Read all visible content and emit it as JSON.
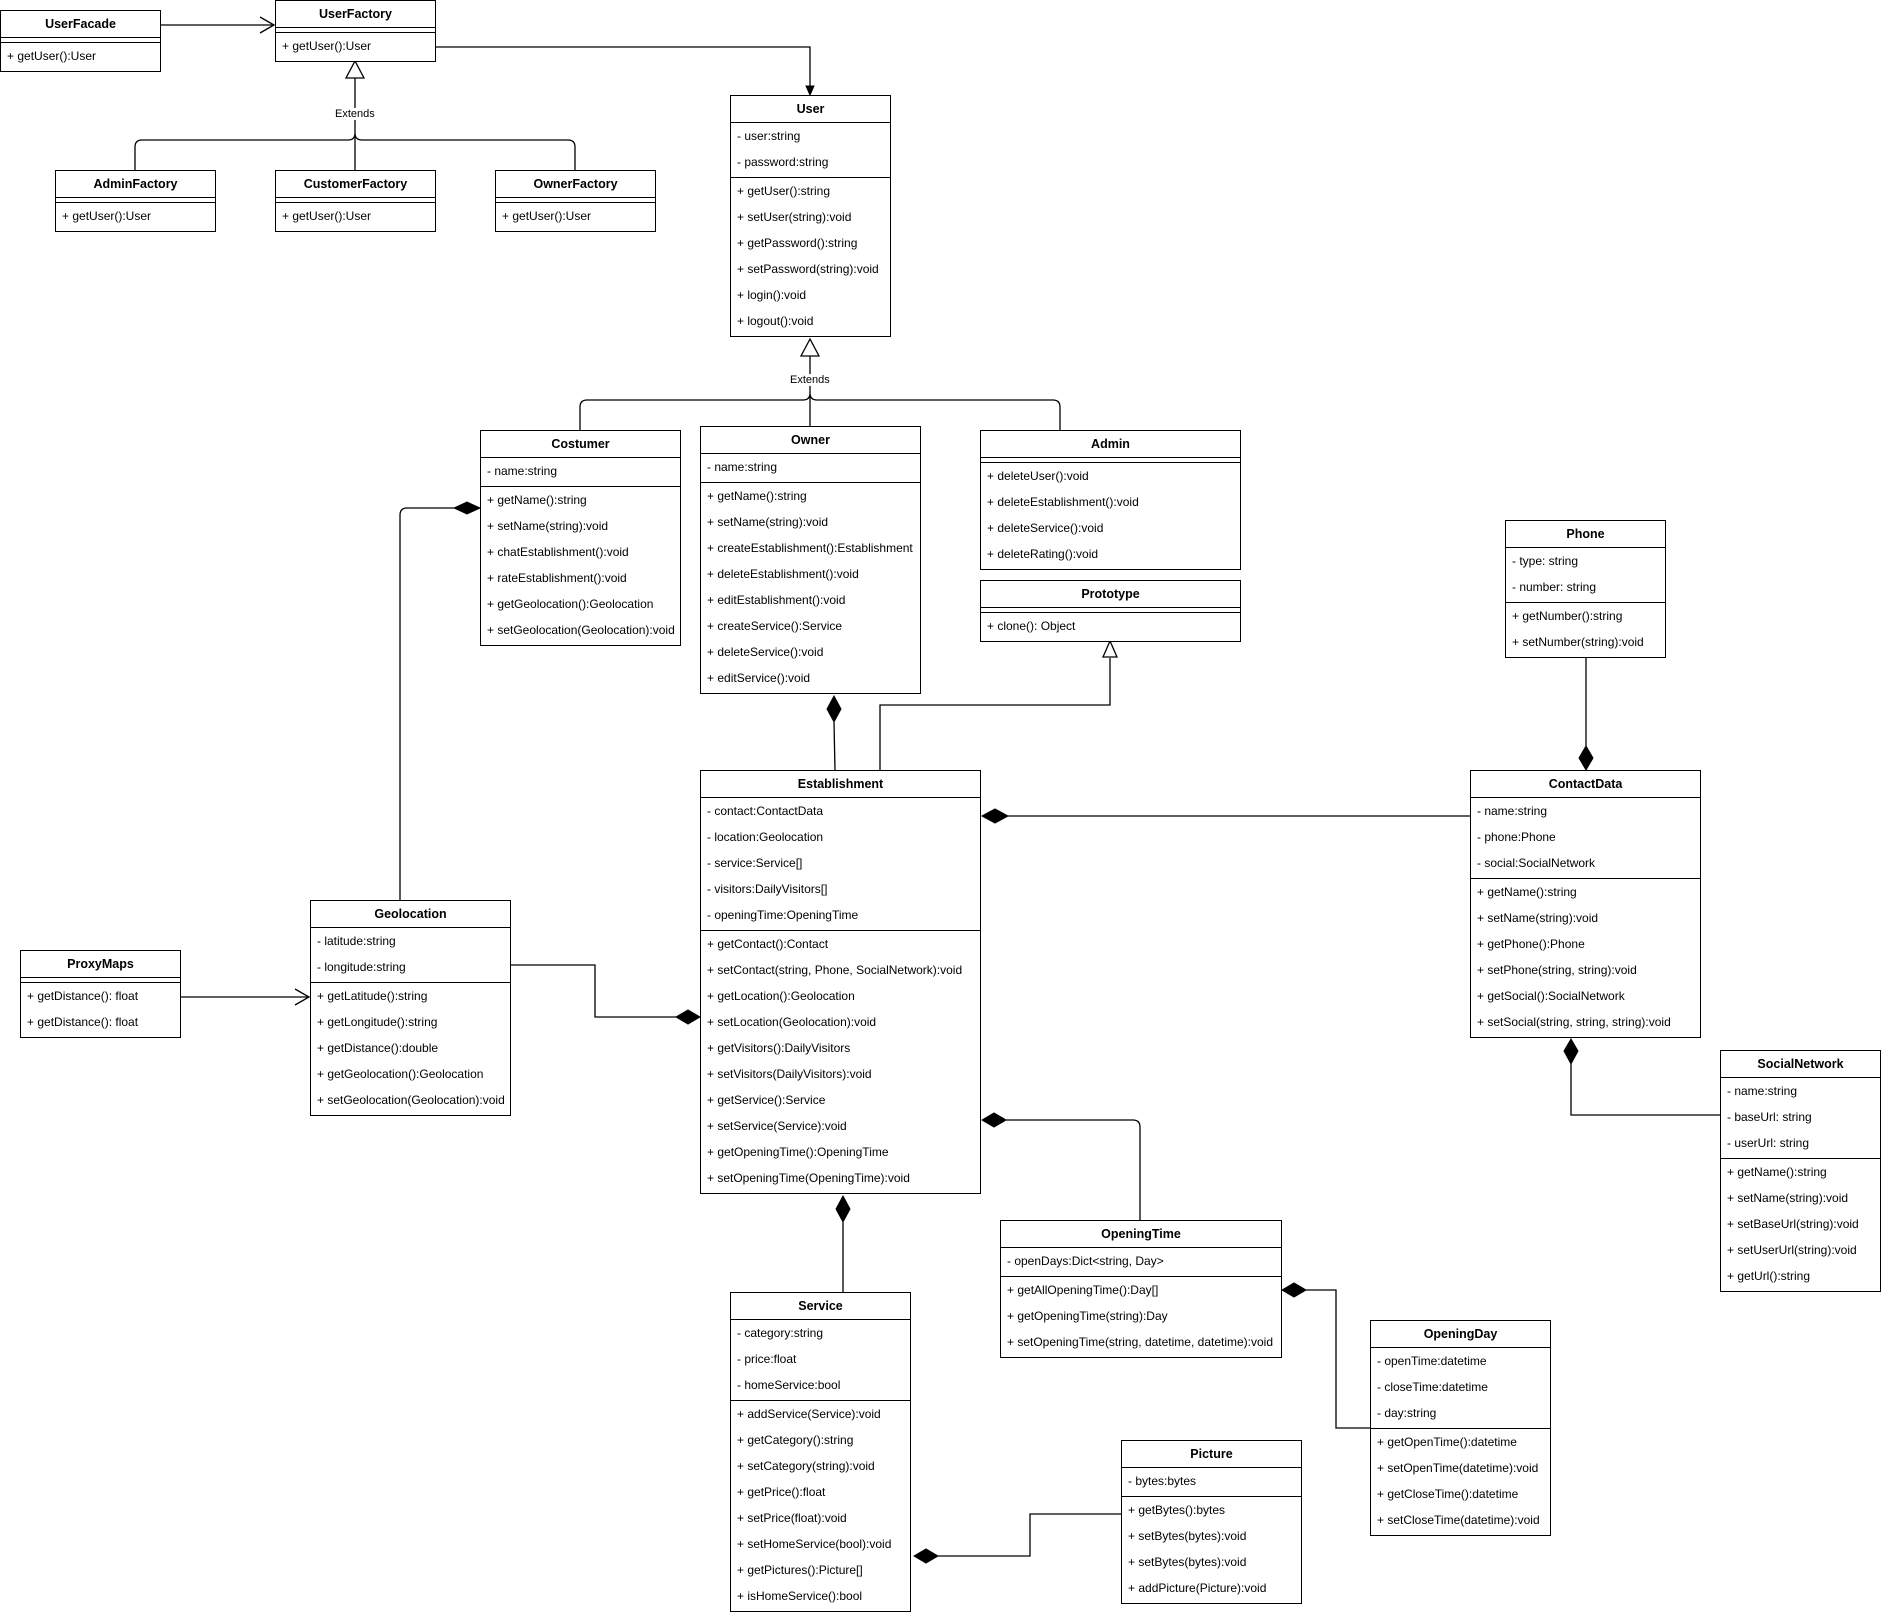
{
  "diagram": {
    "type": "UML class diagram",
    "relation_labels": {
      "extends_factory": "Extends",
      "extends_user": "Extends"
    },
    "classes": {
      "UserFacade": {
        "name": "UserFacade",
        "attributes": [],
        "methods": [
          "+ getUser():User"
        ]
      },
      "UserFactory": {
        "name": "UserFactory",
        "attributes": [],
        "methods": [
          "+ getUser():User"
        ]
      },
      "AdminFactory": {
        "name": "AdminFactory",
        "attributes": [],
        "methods": [
          "+ getUser():User"
        ]
      },
      "CustomerFactory": {
        "name": "CustomerFactory",
        "attributes": [],
        "methods": [
          "+ getUser():User"
        ]
      },
      "OwnerFactory": {
        "name": "OwnerFactory",
        "attributes": [],
        "methods": [
          "+ getUser():User"
        ]
      },
      "User": {
        "name": "User",
        "attributes": [
          "- user:string",
          "- password:string"
        ],
        "methods": [
          "+ getUser():string",
          "+ setUser(string):void",
          "+ getPassword():string",
          "+ setPassword(string):void",
          "+ login():void",
          "+ logout():void"
        ]
      },
      "Costumer": {
        "name": "Costumer",
        "attributes": [
          "- name:string"
        ],
        "methods": [
          "+ getName():string",
          "+ setName(string):void",
          "+ chatEstablishment():void",
          "+ rateEstablishment():void",
          "+ getGeolocation():Geolocation",
          "+ setGeolocation(Geolocation):void"
        ]
      },
      "Owner": {
        "name": "Owner",
        "attributes": [
          "- name:string"
        ],
        "methods": [
          "+ getName():string",
          "+ setName(string):void",
          "+ createEstablishment():Establishment",
          "+ deleteEstablishment():void",
          "+ editEstablishment():void",
          "+ createService():Service",
          "+ deleteService():void",
          "+ editService():void"
        ]
      },
      "Admin": {
        "name": "Admin",
        "attributes": [],
        "methods": [
          "+ deleteUser():void",
          "+ deleteEstablishment():void",
          "+ deleteService():void",
          "+ deleteRating():void"
        ]
      },
      "Prototype": {
        "name": "Prototype",
        "attributes": [],
        "methods": [
          "+ clone(): Object"
        ]
      },
      "Phone": {
        "name": "Phone",
        "attributes": [
          "- type: string",
          "- number: string"
        ],
        "methods": [
          "+ getNumber():string",
          "+ setNumber(string):void"
        ]
      },
      "Establishment": {
        "name": "Establishment",
        "attributes": [
          "- contact:ContactData",
          "- location:Geolocation",
          "- service:Service[]",
          "- visitors:DailyVisitors[]",
          "- openingTime:OpeningTime"
        ],
        "methods": [
          "+ getContact():Contact",
          "+ setContact(string, Phone, SocialNetwork):void",
          "+ getLocation():Geolocation",
          "+ setLocation(Geolocation):void",
          "+ getVisitors():DailyVisitors",
          "+ setVisitors(DailyVisitors):void",
          "+ getService():Service",
          "+ setService(Service):void",
          "+ getOpeningTime():OpeningTime",
          "+ setOpeningTime(OpeningTime):void"
        ]
      },
      "ContactData": {
        "name": "ContactData",
        "attributes": [
          "- name:string",
          "- phone:Phone",
          "- social:SocialNetwork"
        ],
        "methods": [
          "+ getName():string",
          "+ setName(string):void",
          "+ getPhone():Phone",
          "+ setPhone(string, string):void",
          "+ getSocial():SocialNetwork",
          "+ setSocial(string, string, string):void"
        ]
      },
      "Geolocation": {
        "name": "Geolocation",
        "attributes": [
          "- latitude:string",
          "- longitude:string"
        ],
        "methods": [
          "+ getLatitude():string",
          "+ getLongitude():string",
          "+ getDistance():double",
          "+ getGeolocation():Geolocation",
          "+ setGeolocation(Geolocation):void"
        ]
      },
      "ProxyMaps": {
        "name": "ProxyMaps",
        "attributes": [],
        "methods": [
          "+ getDistance(): float",
          "+ getDistance(): float"
        ]
      },
      "SocialNetwork": {
        "name": "SocialNetwork",
        "attributes": [
          "- name:string",
          "- baseUrl: string",
          "- userUrl: string"
        ],
        "methods": [
          "+ getName():string",
          "+ setName(string):void",
          "+ setBaseUrl(string):void",
          "+ setUserUrl(string):void",
          "+ getUrl():string"
        ]
      },
      "OpeningTime": {
        "name": "OpeningTime",
        "attributes": [
          "- openDays:Dict<string, Day>"
        ],
        "methods": [
          "+ getAllOpeningTime():Day[]",
          "+ getOpeningTime(string):Day",
          "+ setOpeningTime(string, datetime, datetime):void"
        ]
      },
      "Service": {
        "name": "Service",
        "attributes": [
          "- category:string",
          "- price:float",
          "- homeService:bool"
        ],
        "methods": [
          "+ addService(Service):void",
          "+ getCategory():string",
          "+ setCategory(string):void",
          "+ getPrice():float",
          "+ setPrice(float):void",
          "+ setHomeService(bool):void",
          "+ getPictures():Picture[]",
          "+ isHomeService():bool"
        ]
      },
      "OpeningDay": {
        "name": "OpeningDay",
        "attributes": [
          "- openTime:datetime",
          "- closeTime:datetime",
          "- day:string"
        ],
        "methods": [
          "+ getOpenTime():datetime",
          "+ setOpenTime(datetime):void",
          "+ getCloseTime():datetime",
          "+ setCloseTime(datetime):void"
        ]
      },
      "Picture": {
        "name": "Picture",
        "attributes": [
          "- bytes:bytes"
        ],
        "methods": [
          "+ getBytes():bytes",
          "+ setBytes(bytes):void",
          "+ setBytes(bytes):void",
          "+ addPicture(Picture):void"
        ]
      }
    },
    "relationships": [
      {
        "from": "UserFacade",
        "to": "UserFactory",
        "kind": "dependency"
      },
      {
        "from": "UserFactory",
        "to": "User",
        "kind": "association"
      },
      {
        "from": "AdminFactory",
        "to": "UserFactory",
        "kind": "generalization",
        "label": "Extends"
      },
      {
        "from": "CustomerFactory",
        "to": "UserFactory",
        "kind": "generalization",
        "label": "Extends"
      },
      {
        "from": "OwnerFactory",
        "to": "UserFactory",
        "kind": "generalization",
        "label": "Extends"
      },
      {
        "from": "Costumer",
        "to": "User",
        "kind": "generalization",
        "label": "Extends"
      },
      {
        "from": "Owner",
        "to": "User",
        "kind": "generalization",
        "label": "Extends"
      },
      {
        "from": "Admin",
        "to": "User",
        "kind": "generalization",
        "label": "Extends"
      },
      {
        "from": "Establishment",
        "to": "Prototype",
        "kind": "realization"
      },
      {
        "from": "Establishment",
        "to": "Owner",
        "kind": "composition"
      },
      {
        "from": "Geolocation",
        "to": "Costumer",
        "kind": "composition"
      },
      {
        "from": "Geolocation",
        "to": "Establishment",
        "kind": "composition"
      },
      {
        "from": "ProxyMaps",
        "to": "Geolocation",
        "kind": "dependency"
      },
      {
        "from": "ContactData",
        "to": "Establishment",
        "kind": "composition"
      },
      {
        "from": "Phone",
        "to": "ContactData",
        "kind": "composition"
      },
      {
        "from": "SocialNetwork",
        "to": "ContactData",
        "kind": "composition"
      },
      {
        "from": "OpeningTime",
        "to": "Establishment",
        "kind": "composition"
      },
      {
        "from": "Service",
        "to": "Establishment",
        "kind": "composition"
      },
      {
        "from": "OpeningDay",
        "to": "OpeningTime",
        "kind": "composition"
      },
      {
        "from": "Picture",
        "to": "Service",
        "kind": "composition"
      }
    ]
  }
}
